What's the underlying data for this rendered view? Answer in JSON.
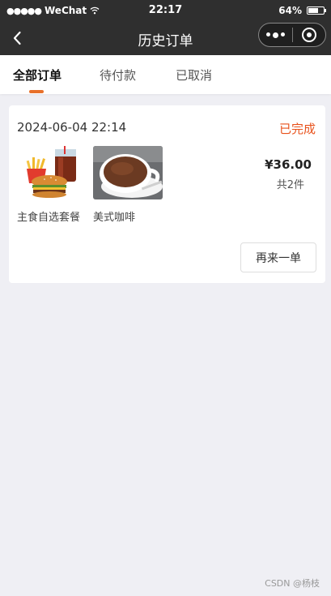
{
  "status_bar": {
    "signal": "●●●●●",
    "carrier": "WeChat",
    "wifi_icon": "wifi-icon",
    "time": "22:17",
    "battery_label": "64%",
    "battery_level": 0.64
  },
  "nav": {
    "title": "历史订单",
    "back_icon": "chevron-left-icon"
  },
  "tabs": [
    {
      "label": "全部订单",
      "active": true
    },
    {
      "label": "待付款",
      "active": false
    },
    {
      "label": "已取消",
      "active": false
    }
  ],
  "order": {
    "time": "2024-06-04 22:14",
    "status": "已完成",
    "products": [
      {
        "name": "主食自选套餐",
        "image": "burger-combo-image"
      },
      {
        "name": "美式咖啡",
        "image": "coffee-cup-image"
      }
    ],
    "price": "¥36.00",
    "count": "共2件",
    "reorder_label": "再来一单"
  },
  "watermark": "CSDN @杨枝",
  "colors": {
    "status_bar_bg": "#2f2f2f",
    "accent_orange": "#e8702a",
    "status_completed": "#e8521c",
    "page_bg": "#efeff4"
  }
}
